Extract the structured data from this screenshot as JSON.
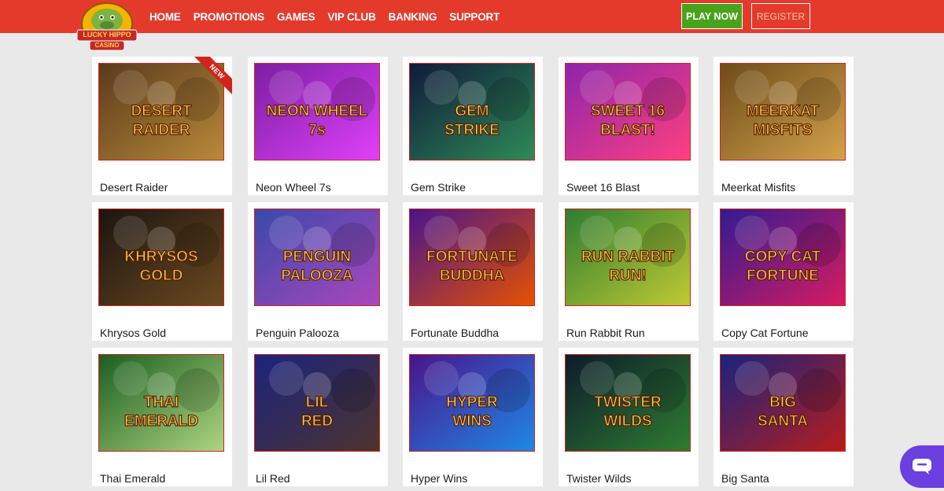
{
  "brand": {
    "logo_text_top": "LUCKY HIPPO",
    "logo_text_bottom": "CASINO"
  },
  "nav": [
    {
      "label": "HOME"
    },
    {
      "label": "PROMOTIONS"
    },
    {
      "label": "GAMES"
    },
    {
      "label": "VIP CLUB"
    },
    {
      "label": "BANKING"
    },
    {
      "label": "SUPPORT"
    }
  ],
  "header": {
    "play_label": "PLAY NOW",
    "register_label": "REGISTER"
  },
  "badge": {
    "new": "NEW"
  },
  "games": [
    {
      "title": "Desert Raider",
      "art": "DESERT RAIDER",
      "colors": [
        "#5a3a1c",
        "#b98a3a"
      ]
    },
    {
      "title": "Neon Wheel 7s",
      "art": "NEON WHEEL 7s",
      "colors": [
        "#7b1fa2",
        "#e040fb"
      ]
    },
    {
      "title": "Gem Strike",
      "art": "GEM STRIKE",
      "colors": [
        "#101a3a",
        "#2e8b57"
      ]
    },
    {
      "title": "Sweet 16 Blast",
      "art": "SWEET 16 BLAST!",
      "colors": [
        "#8e24aa",
        "#ff4081"
      ]
    },
    {
      "title": "Meerkat Misfits",
      "art": "MEERKAT MISFITS",
      "colors": [
        "#6d4c1a",
        "#d4a24c"
      ]
    },
    {
      "title": "Khrysos Gold",
      "art": "KHRYSOS GOLD",
      "colors": [
        "#1b1410",
        "#6b4a20"
      ]
    },
    {
      "title": "Penguin Palooza",
      "art": "PENGUIN PALOOZA",
      "colors": [
        "#3949ab",
        "#ab47bc"
      ]
    },
    {
      "title": "Fortunate Buddha",
      "art": "FORTUNATE BUDDHA",
      "colors": [
        "#4a148c",
        "#e65100"
      ]
    },
    {
      "title": "Run Rabbit Run",
      "art": "RUN RABBIT RUN!",
      "colors": [
        "#2e7d32",
        "#c0ca33"
      ]
    },
    {
      "title": "Copy Cat Fortune",
      "art": "COPY CAT FORTUNE",
      "colors": [
        "#311b92",
        "#d81b60"
      ]
    },
    {
      "title": "Thai Emerald",
      "art": "THAI EMERALD",
      "colors": [
        "#1b5e20",
        "#aed581"
      ]
    },
    {
      "title": "Lil Red",
      "art": "LIL RED",
      "colors": [
        "#1a237e",
        "#4e342e"
      ]
    },
    {
      "title": "Hyper Wins",
      "art": "HYPER WINS",
      "colors": [
        "#4a148c",
        "#1e88e5"
      ]
    },
    {
      "title": "Twister Wilds",
      "art": "TWISTER WILDS",
      "colors": [
        "#0d1b2a",
        "#2e7d32"
      ]
    },
    {
      "title": "Big Santa",
      "art": "BIG SANTA",
      "colors": [
        "#1a237e",
        "#b71c1c"
      ]
    }
  ],
  "icons": {
    "chat": "chat-bubble-icon"
  }
}
